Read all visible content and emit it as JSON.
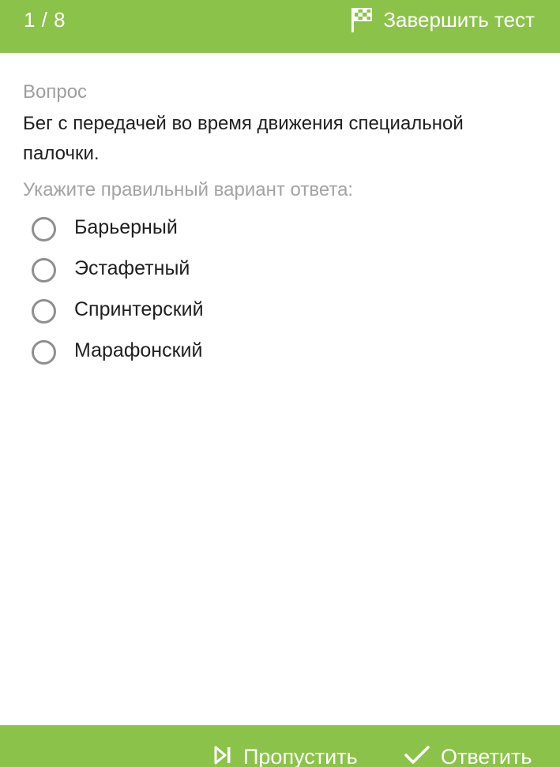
{
  "header": {
    "progress": "1 / 8",
    "finish_label": "Завершить тест",
    "finish_icon": "checkered-flag-icon"
  },
  "question": {
    "caption": "Вопрос",
    "text": "Бег с передачей во время движения специальной палочки.",
    "instruction": "Укажите правильный вариант ответа:",
    "options": [
      {
        "label": "Барьерный",
        "selected": false
      },
      {
        "label": "Эстафетный",
        "selected": false
      },
      {
        "label": "Спринтерский",
        "selected": false
      },
      {
        "label": "Марафонский",
        "selected": false
      }
    ]
  },
  "footer": {
    "skip_label": "Пропустить",
    "skip_icon": "skip-next-icon",
    "answer_label": "Ответить",
    "answer_icon": "checkmark-icon"
  },
  "colors": {
    "accent": "#8bc34a",
    "radio_border": "#8f8f8f",
    "muted_text": "#9e9e9e"
  }
}
